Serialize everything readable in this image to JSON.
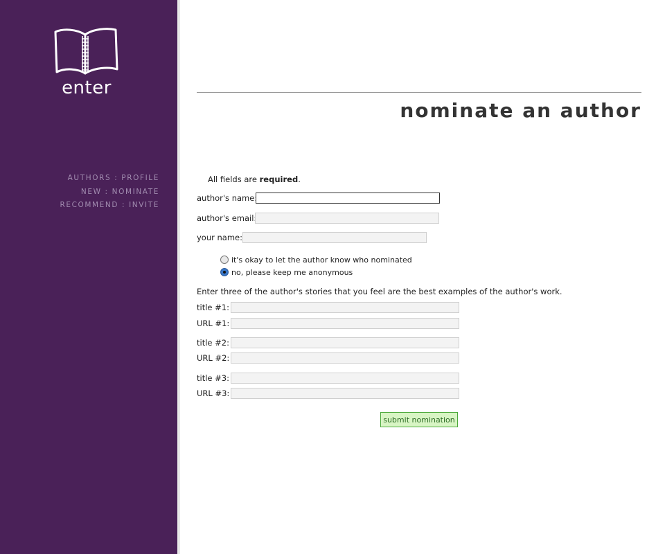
{
  "brand": {
    "logo_text": "enter",
    "logo_icon": "open-book-icon"
  },
  "nav": [
    {
      "left": "AUTHORS",
      "sep": ":",
      "right": "PROFILE"
    },
    {
      "left": "NEW",
      "sep": ":",
      "right": "NOMINATE"
    },
    {
      "left": "RECOMMEND",
      "sep": ":",
      "right": "INVITE"
    }
  ],
  "page": {
    "title": "nominate an author"
  },
  "form": {
    "required_prefix": "All fields are ",
    "required_word": "required",
    "required_suffix": ".",
    "author_name_label": "author's name:",
    "author_name_value": "",
    "author_email_label": "author's email:",
    "author_email_value": "",
    "your_name_label": "your name:",
    "your_name_value": "",
    "radio_reveal_label": "it's okay to let the author know who nominated",
    "radio_anonymous_label": "no, please keep me anonymous",
    "radio_selected": "anonymous",
    "stories_instructions": "Enter three of the author's stories that you feel are the best examples of the author's work.",
    "stories": [
      {
        "title_label": "title #1:",
        "title_value": "",
        "url_label": "URL #1:",
        "url_value": ""
      },
      {
        "title_label": "title #2:",
        "title_value": "",
        "url_label": "URL #2:",
        "url_value": ""
      },
      {
        "title_label": "title #3:",
        "title_value": "",
        "url_label": "URL #3:",
        "url_value": ""
      }
    ],
    "submit_label": "submit nomination"
  },
  "colors": {
    "sidebar": "#4a2158",
    "nav_text": "#a28db0",
    "submit_bg": "#d8f5c4",
    "submit_border": "#4aa83a",
    "radio_selected": "#3a78c9"
  }
}
